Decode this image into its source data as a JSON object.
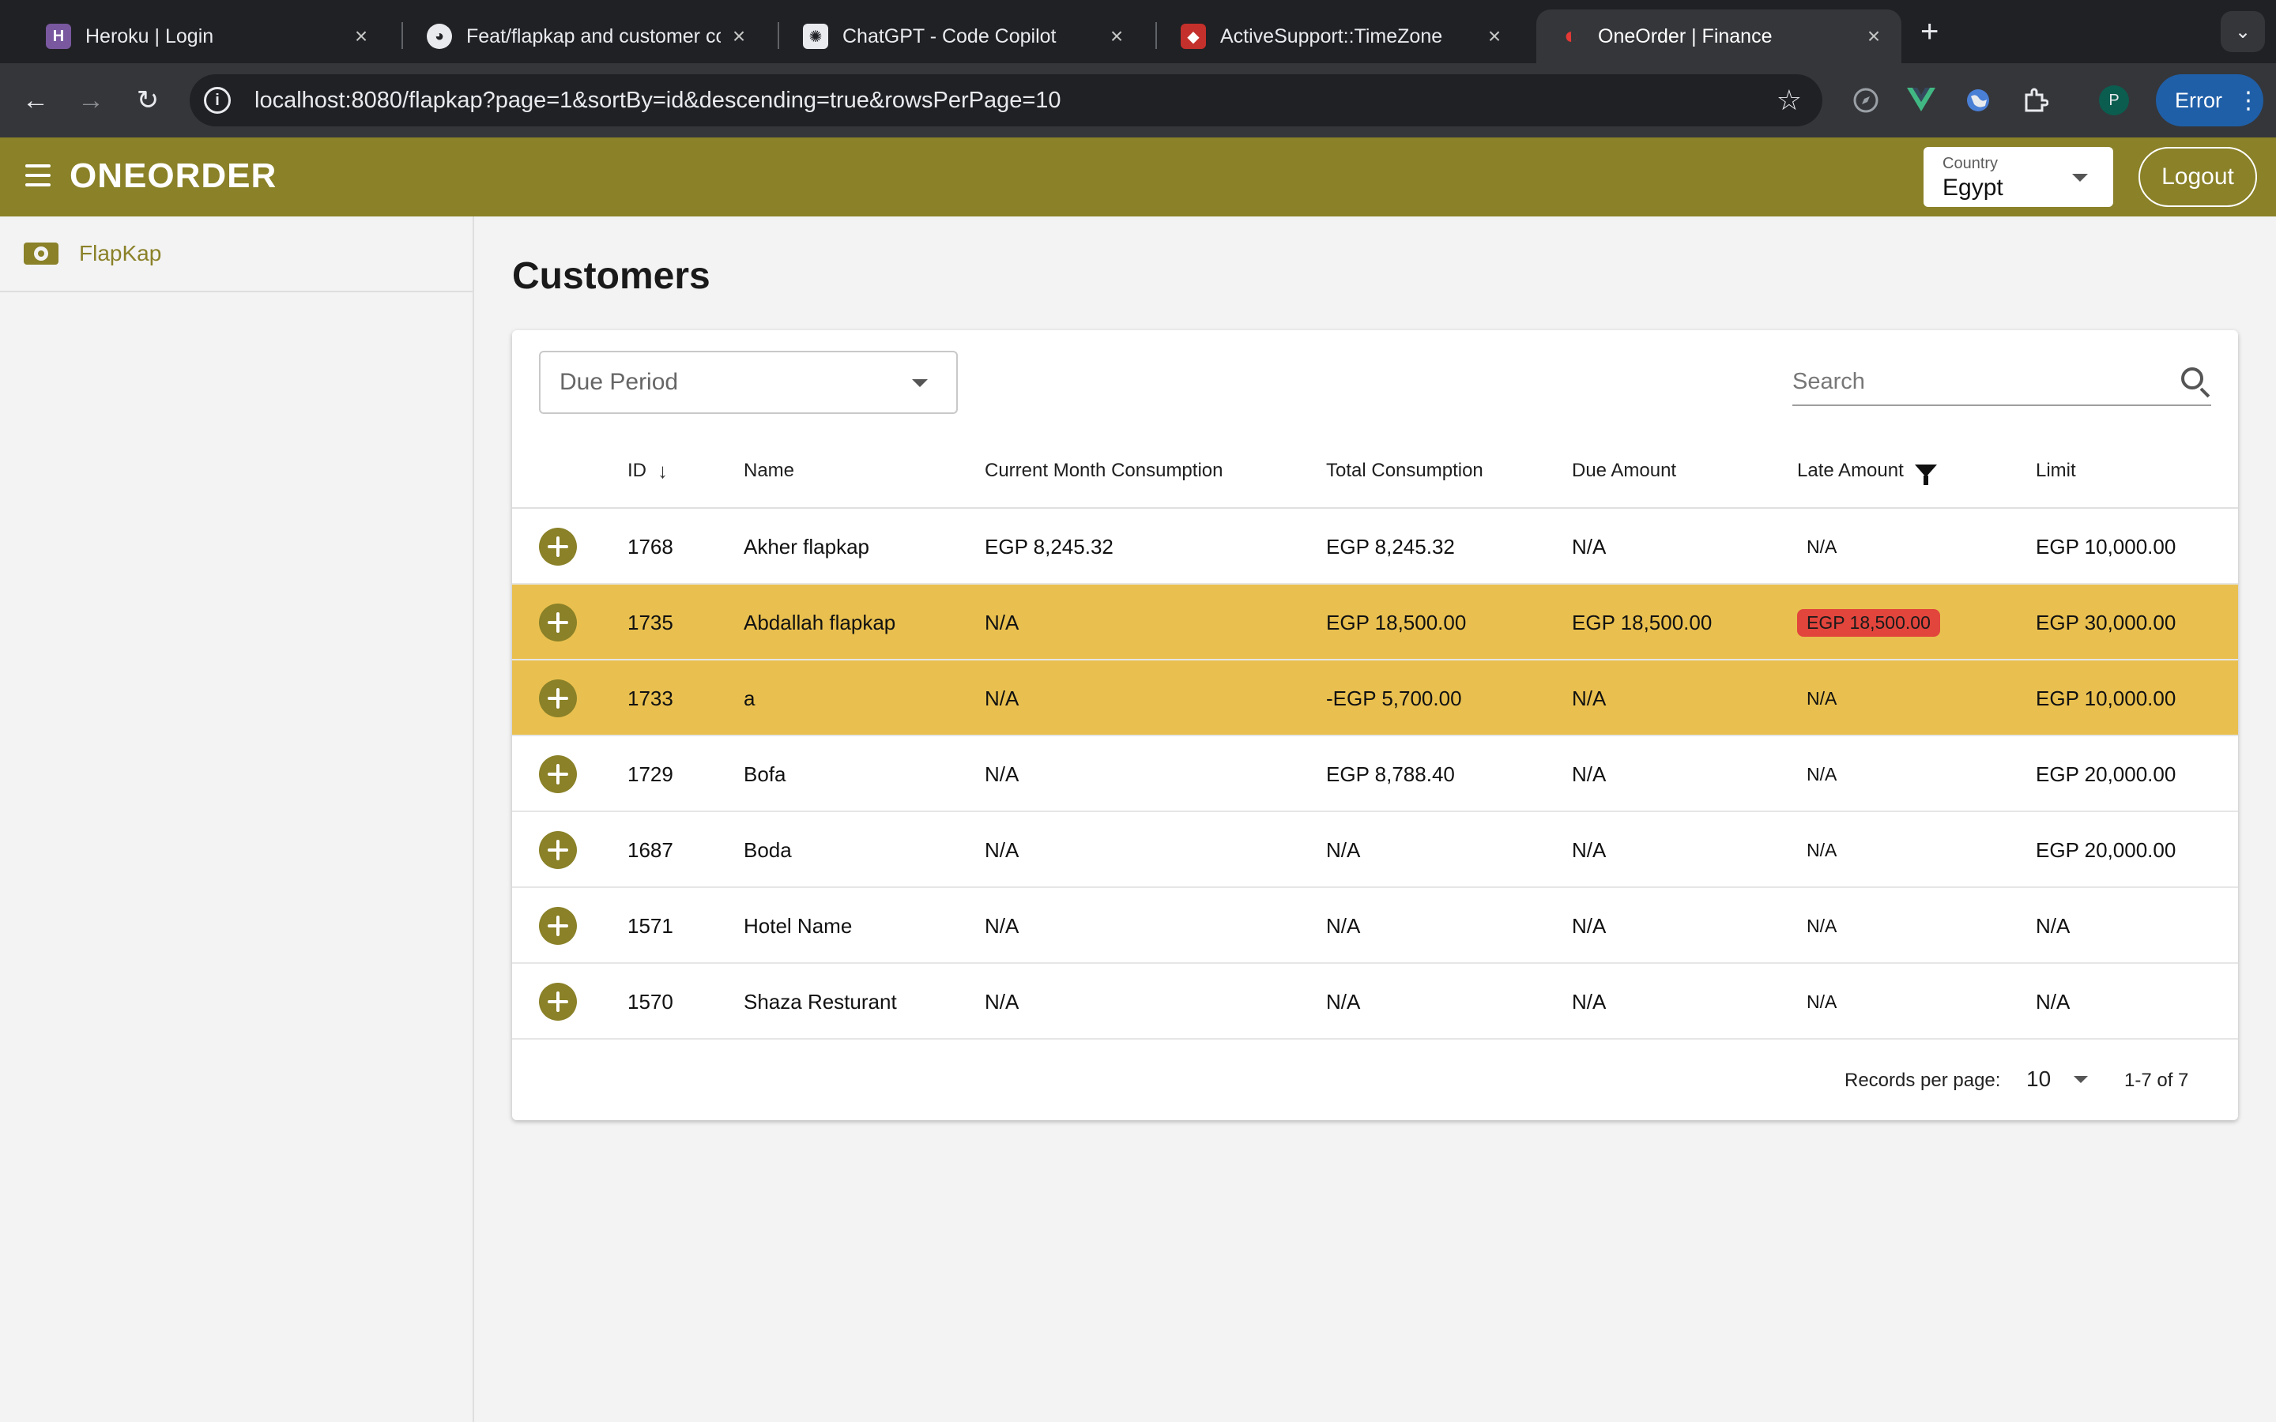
{
  "browser": {
    "tabs": [
      {
        "title": "Heroku | Login"
      },
      {
        "title": "Feat/flapkap and customer co"
      },
      {
        "title": "ChatGPT - Code Copilot"
      },
      {
        "title": "ActiveSupport::TimeZone"
      },
      {
        "title": "OneOrder | Finance"
      }
    ],
    "url": "localhost:8080/flapkap?page=1&sortBy=id&descending=true&rowsPerPage=10",
    "profile_initial": "P",
    "error_label": "Error"
  },
  "app": {
    "logo": "ONEORDER",
    "country": {
      "label": "Country",
      "value": "Egypt"
    },
    "logout_label": "Logout",
    "brand_color": "#8a8128",
    "highlight_color": "#e9c04f",
    "late_badge_color": "#e2453c"
  },
  "sidebar": {
    "items": [
      {
        "label": "FlapKap",
        "icon": "cash-icon"
      }
    ]
  },
  "main": {
    "title": "Customers",
    "due_period_placeholder": "Due Period",
    "search_placeholder": "Search",
    "columns": [
      "ID",
      "Name",
      "Current Month Consumption",
      "Total Consumption",
      "Due Amount",
      "Late Amount",
      "Limit"
    ],
    "rows": [
      {
        "id": "1768",
        "name": "Akher flapkap",
        "current": "EGP 8,245.32",
        "total": "EGP 8,245.32",
        "due": "N/A",
        "late": "N/A",
        "limit": "EGP 10,000.00"
      },
      {
        "id": "1735",
        "name": "Abdallah flapkap",
        "current": "N/A",
        "total": "EGP 18,500.00",
        "due": "EGP 18,500.00",
        "late": "EGP 18,500.00",
        "limit": "EGP 30,000.00"
      },
      {
        "id": "1733",
        "name": "a",
        "current": "N/A",
        "total": "-EGP 5,700.00",
        "due": "N/A",
        "late": "N/A",
        "limit": "EGP 10,000.00"
      },
      {
        "id": "1729",
        "name": "Bofa",
        "current": "N/A",
        "total": "EGP 8,788.40",
        "due": "N/A",
        "late": "N/A",
        "limit": "EGP 20,000.00"
      },
      {
        "id": "1687",
        "name": "Boda",
        "current": "N/A",
        "total": "N/A",
        "due": "N/A",
        "late": "N/A",
        "limit": "EGP 20,000.00"
      },
      {
        "id": "1571",
        "name": "Hotel Name",
        "current": "N/A",
        "total": "N/A",
        "due": "N/A",
        "late": "N/A",
        "limit": "N/A"
      },
      {
        "id": "1570",
        "name": "Shaza Resturant",
        "current": "N/A",
        "total": "N/A",
        "due": "N/A",
        "late": "N/A",
        "limit": "N/A"
      }
    ],
    "pagination": {
      "label": "Records per page:",
      "per_page": "10",
      "range": "1-7 of 7"
    }
  }
}
